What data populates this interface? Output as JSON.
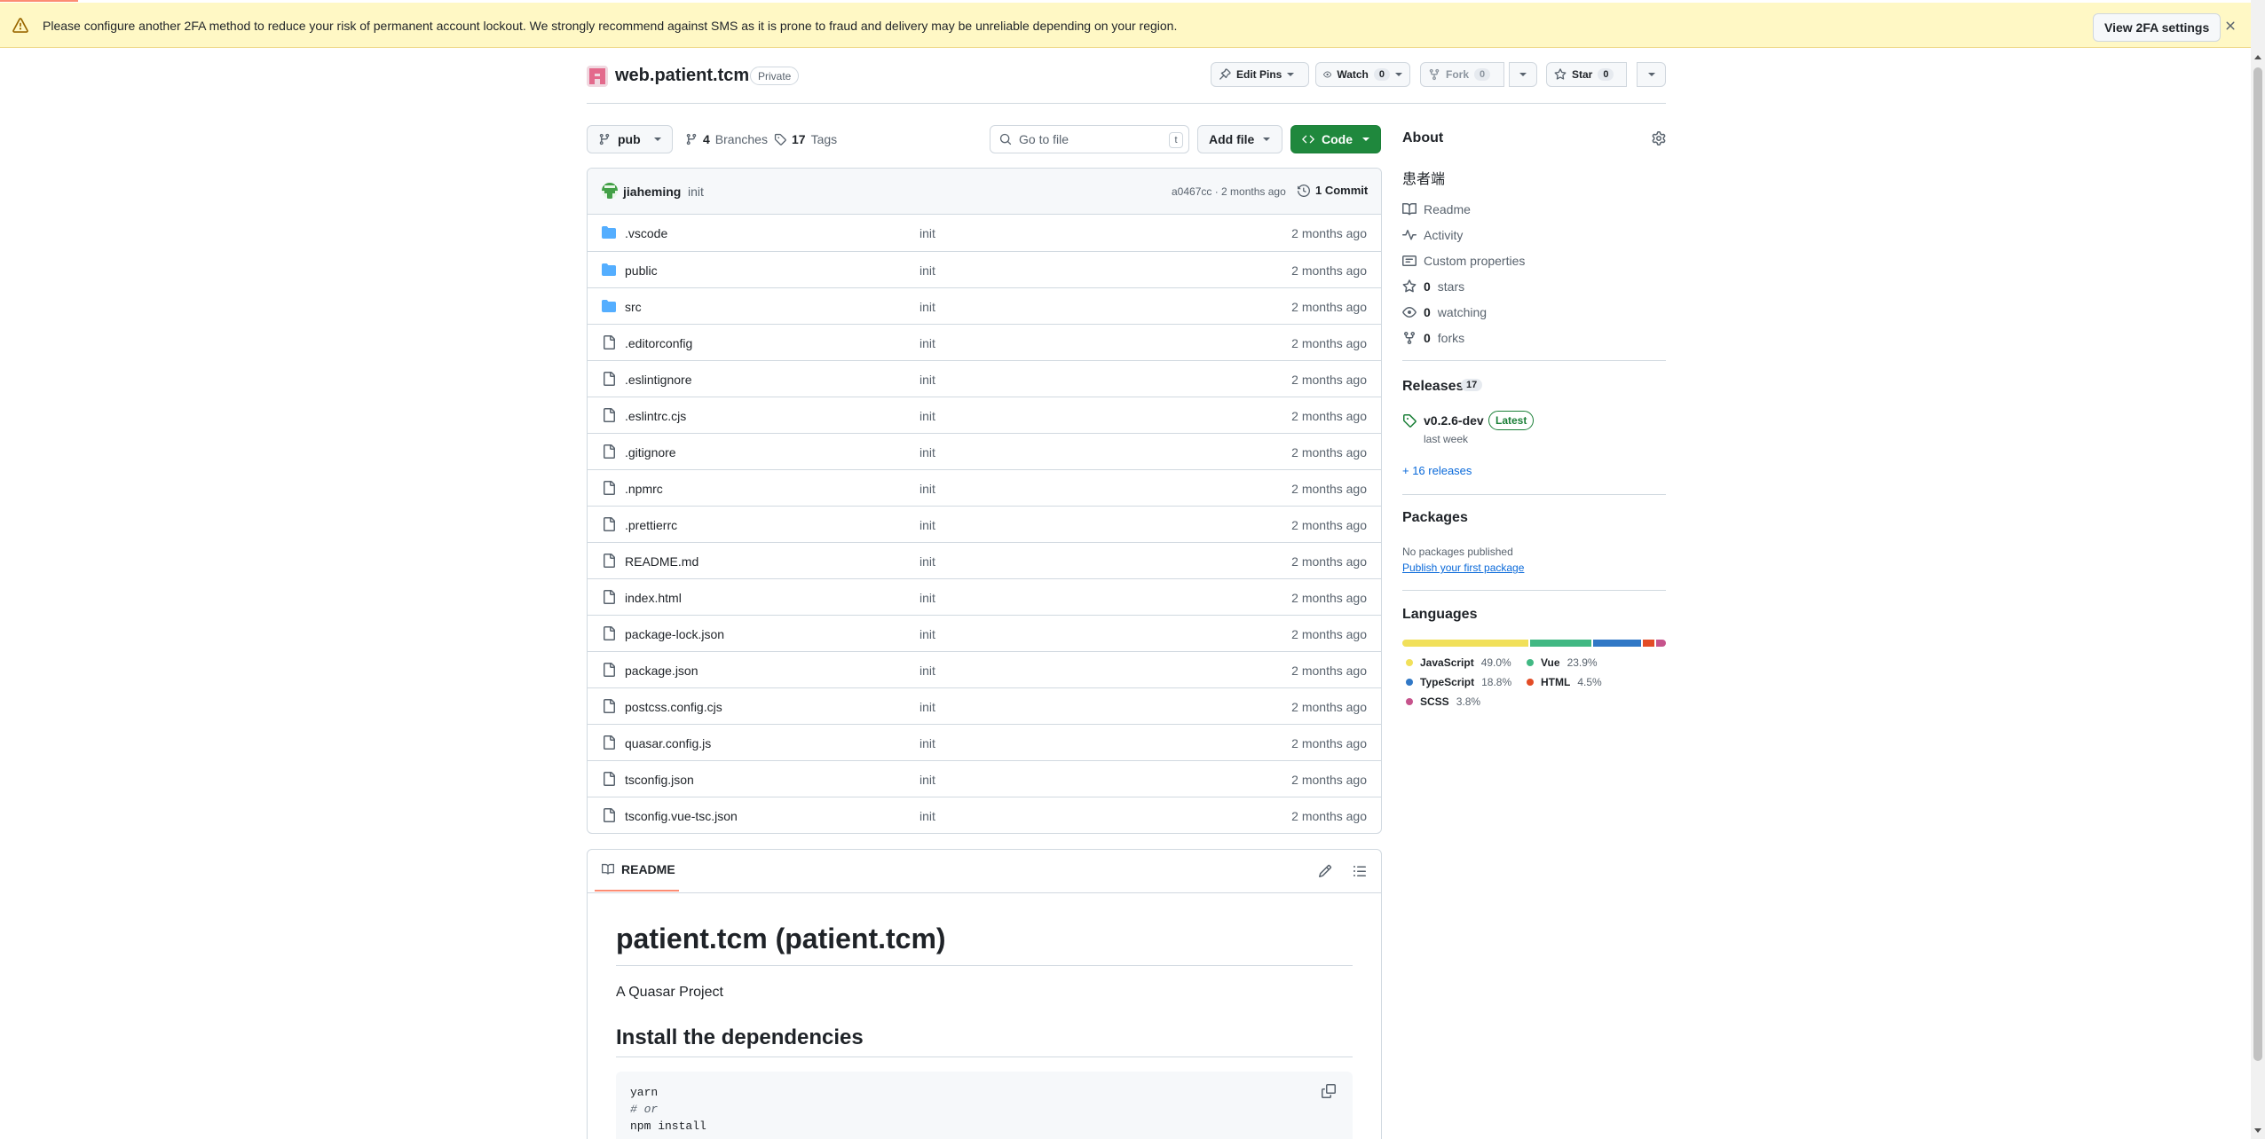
{
  "banner": {
    "message": "Please configure another 2FA method to reduce your risk of permanent account lockout. We strongly recommend against SMS as it is prone to fraud and delivery may be unreliable depending on your region.",
    "button": "View 2FA settings",
    "icons": {
      "warning": "alert-icon",
      "close": "x-icon"
    }
  },
  "repo": {
    "name": "web.patient.tcm",
    "visibility": "Private"
  },
  "actions": {
    "edit_pins": "Edit Pins",
    "watch": "Watch",
    "watch_count": "0",
    "fork": "Fork",
    "fork_count": "0",
    "star": "Star",
    "star_count": "0"
  },
  "toolbar": {
    "branch": "pub",
    "branches_count": "4",
    "branches_label": "Branches",
    "tags_count": "17",
    "tags_label": "Tags",
    "goto_placeholder": "Go to file",
    "goto_shortcut": "t",
    "add_file": "Add file",
    "code": "Code"
  },
  "latest_commit": {
    "author": "jiaheming",
    "message": "init",
    "meta": "a0467cc · 2 months ago",
    "count_label": "1 Commit"
  },
  "files": [
    {
      "name": ".vscode",
      "type": "dir",
      "commit": "init",
      "time": "2 months ago"
    },
    {
      "name": "public",
      "type": "dir",
      "commit": "init",
      "time": "2 months ago"
    },
    {
      "name": "src",
      "type": "dir",
      "commit": "init",
      "time": "2 months ago"
    },
    {
      "name": ".editorconfig",
      "type": "file",
      "commit": "init",
      "time": "2 months ago"
    },
    {
      "name": ".eslintignore",
      "type": "file",
      "commit": "init",
      "time": "2 months ago"
    },
    {
      "name": ".eslintrc.cjs",
      "type": "file",
      "commit": "init",
      "time": "2 months ago"
    },
    {
      "name": ".gitignore",
      "type": "file",
      "commit": "init",
      "time": "2 months ago"
    },
    {
      "name": ".npmrc",
      "type": "file",
      "commit": "init",
      "time": "2 months ago"
    },
    {
      "name": ".prettierrc",
      "type": "file",
      "commit": "init",
      "time": "2 months ago"
    },
    {
      "name": "README.md",
      "type": "file",
      "commit": "init",
      "time": "2 months ago"
    },
    {
      "name": "index.html",
      "type": "file",
      "commit": "init",
      "time": "2 months ago"
    },
    {
      "name": "package-lock.json",
      "type": "file",
      "commit": "init",
      "time": "2 months ago"
    },
    {
      "name": "package.json",
      "type": "file",
      "commit": "init",
      "time": "2 months ago"
    },
    {
      "name": "postcss.config.cjs",
      "type": "file",
      "commit": "init",
      "time": "2 months ago"
    },
    {
      "name": "quasar.config.js",
      "type": "file",
      "commit": "init",
      "time": "2 months ago"
    },
    {
      "name": "tsconfig.json",
      "type": "file",
      "commit": "init",
      "time": "2 months ago"
    },
    {
      "name": "tsconfig.vue-tsc.json",
      "type": "file",
      "commit": "init",
      "time": "2 months ago"
    }
  ],
  "readme": {
    "tab": "README",
    "title": "patient.tcm (patient.tcm)",
    "intro": "A Quasar Project",
    "section": "Install the dependencies",
    "code_lines": [
      "yarn",
      "# or",
      "npm install"
    ]
  },
  "about": {
    "heading": "About",
    "description": "患者端",
    "links": [
      {
        "icon": "book-icon",
        "label": "Readme",
        "count": ""
      },
      {
        "icon": "pulse-icon",
        "label": "Activity",
        "count": ""
      },
      {
        "icon": "note-icon",
        "label": "Custom properties",
        "count": ""
      },
      {
        "icon": "star-icon",
        "label": "stars",
        "count": "0"
      },
      {
        "icon": "eye-icon",
        "label": "watching",
        "count": "0"
      },
      {
        "icon": "fork-icon",
        "label": "forks",
        "count": "0"
      }
    ]
  },
  "releases": {
    "heading": "Releases",
    "count": "17",
    "latest_name": "v0.2.6-dev",
    "latest_badge": "Latest",
    "latest_when": "last week",
    "more": "+ 16 releases"
  },
  "packages": {
    "heading": "Packages",
    "none": "No packages published",
    "link": "Publish your first package"
  },
  "languages": {
    "heading": "Languages",
    "items": [
      {
        "name": "JavaScript",
        "percent": 49.0,
        "label": "49.0%",
        "color": "#f1e05a"
      },
      {
        "name": "Vue",
        "percent": 23.9,
        "label": "23.9%",
        "color": "#41b883"
      },
      {
        "name": "TypeScript",
        "percent": 18.8,
        "label": "18.8%",
        "color": "#3178c6"
      },
      {
        "name": "HTML",
        "percent": 4.5,
        "label": "4.5%",
        "color": "#e34c26"
      },
      {
        "name": "SCSS",
        "percent": 3.8,
        "label": "3.8%",
        "color": "#c6538c"
      }
    ]
  }
}
